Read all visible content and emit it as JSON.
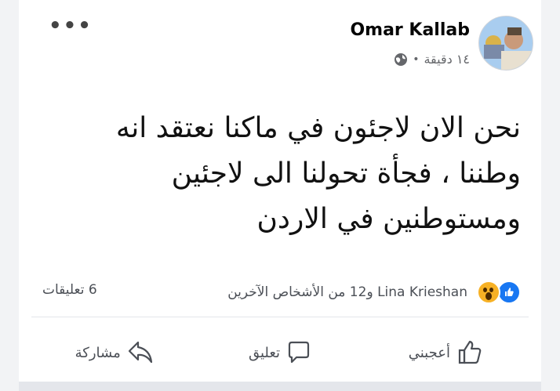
{
  "post": {
    "author": "Omar Kallab",
    "time": "١٤ دقيقة",
    "separator": "•",
    "privacy_icon": "globe-icon",
    "more_label": "•••",
    "text": "نحن الان لاجئون في ماكنا نعتقد انه وطننا ، فجأة تحولنا الى لاجئين ومستوطنين في الاردن"
  },
  "reactions": {
    "summary": "Lina Krieshan و12 من الأشخاص الآخرين",
    "icons": [
      "like-icon",
      "wow-icon"
    ]
  },
  "comments": {
    "count_label": "6 تعليقات"
  },
  "actions": {
    "like": "أعجبني",
    "comment": "تعليق",
    "share": "مشاركة"
  },
  "colors": {
    "like_blue": "#1877f2",
    "wow_yellow": "#f7b125",
    "muted": "#65676b"
  }
}
